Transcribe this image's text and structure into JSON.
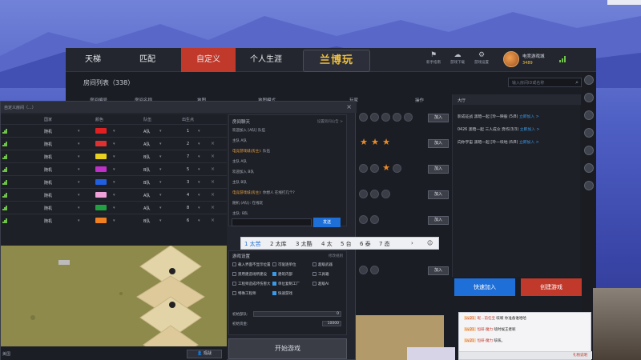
{
  "nav": {
    "items": [
      {
        "label": "天梯"
      },
      {
        "label": "匹配"
      },
      {
        "label": "自定义",
        "active": true
      },
      {
        "label": "个人生涯"
      }
    ]
  },
  "logo": "兰博玩",
  "toolbar": {
    "icons": [
      {
        "label": "新手指南"
      },
      {
        "label": "游戏下载"
      },
      {
        "label": "游戏设置"
      }
    ]
  },
  "user": {
    "name": "电竞游戏城",
    "coins": "3489"
  },
  "room_list": {
    "title": "房间列表（338）",
    "search_placeholder": "输入房间ID或名称",
    "headers": [
      "房间编号",
      "房间名称",
      "地图",
      "地图模式",
      "玩家",
      "操作"
    ],
    "join_label": "加入"
  },
  "lobby": {
    "title": "大厅",
    "messages": [
      {
        "text": "影成征战 黑暗一起 [玲一映般 (5/8)",
        "link": "立即加入 >"
      },
      {
        "text": "0426 黑暗一起 三人成众 奔作(3/3)",
        "link": "立即加入 >"
      },
      {
        "text": "向你宇宙 黑暗一起 [玲一块地 (6/8)",
        "link": "立即加入 >"
      }
    ],
    "quick_join": "快速加入",
    "create_game": "创建游戏"
  },
  "popup": {
    "title": "自定义房间（...）",
    "table_headers": [
      "国家",
      "颜色",
      "队伍",
      "出生点"
    ],
    "players": [
      {
        "country": "随机",
        "color": "#e02020",
        "team": "A队",
        "spawn": "1"
      },
      {
        "country": "随机",
        "color": "#e03030",
        "team": "A队",
        "spawn": "2"
      },
      {
        "country": "随机",
        "color": "#e8d020",
        "team": "B队",
        "spawn": "7"
      },
      {
        "country": "随机",
        "color": "#c030c8",
        "team": "B队",
        "spawn": "5"
      },
      {
        "country": "随机",
        "color": "#2060e0",
        "team": "B队",
        "spawn": "3"
      },
      {
        "country": "随机",
        "color": "#f0a0d8",
        "team": "A队",
        "spawn": "4"
      },
      {
        "country": "随机",
        "color": "#20a040",
        "team": "A队",
        "spawn": "8"
      },
      {
        "country": "随机",
        "color": "#f08020",
        "team": "B队",
        "spawn": "6"
      }
    ],
    "map_label": "美国",
    "observe_label": "观战",
    "chat_title": "房间聊天",
    "chat_settings": "设置房间公告 >",
    "chat_messages": [
      {
        "name": "",
        "text": "欢迎加入 [A队] 队伍"
      },
      {
        "name": "",
        "text": "主队 A队"
      },
      {
        "name": "电竞游戏城(房主)",
        "text": ": 队伍"
      },
      {
        "name": "",
        "text": "主队 A队"
      },
      {
        "name": "",
        "text": "欢迎加入 B队"
      },
      {
        "name": "",
        "text": "主队 B队"
      },
      {
        "name": "电竞游戏城(房主)",
        "text": ": 你想人 在线打几个?"
      },
      {
        "name": "",
        "text": "随机 (A队): 在线玩"
      },
      {
        "name": "",
        "text": "主队: B队"
      }
    ],
    "send_label": "发送",
    "settings_title": "游戏设置",
    "settings_edit": "修改规则",
    "options": [
      {
        "label": "载入界面不显示位置",
        "on": false
      },
      {
        "label": "可驱逐单位",
        "on": false
      },
      {
        "label": "超级武器",
        "on": false
      },
      {
        "label": "禁用建造场所建设",
        "on": false
      },
      {
        "label": "建筑内部",
        "on": true
      },
      {
        "label": "工具箱",
        "on": false
      },
      {
        "label": "工程师造成坏伤害大",
        "on": false
      },
      {
        "label": "单位复制工厂",
        "on": true
      },
      {
        "label": "超级AI",
        "on": false
      },
      {
        "label": "特殊工程师",
        "on": false
      },
      {
        "label": "快速游戏",
        "on": true
      }
    ],
    "initial_units_label": "初始部队:",
    "initial_units_value": "0",
    "initial_funds_label": "初始资金:",
    "initial_funds_value": "10000",
    "start_label": "开始游戏"
  },
  "ime": {
    "candidates": [
      "1 太苦",
      "2 太库",
      "3 太酷",
      "4 太",
      "5 台",
      "6 泰",
      "7 态"
    ],
    "selected": 0
  },
  "chat_overlay": {
    "rows": [
      {
        "level": "Lv.21",
        "name": "昵...前任宝",
        "text": "咳嗽 你准备谁哈哈"
      },
      {
        "level": "Lv.21",
        "name": "恒研·魔力",
        "text": "啥时候王者呢"
      },
      {
        "level": "Lv.21",
        "name": "恒研·魔力",
        "text": "咳咳。"
      }
    ],
    "gift_label": "礼物说明"
  },
  "colors": {
    "accent": "#c0392b",
    "blue": "#1e6fd8",
    "signal": "#6fc24a"
  }
}
